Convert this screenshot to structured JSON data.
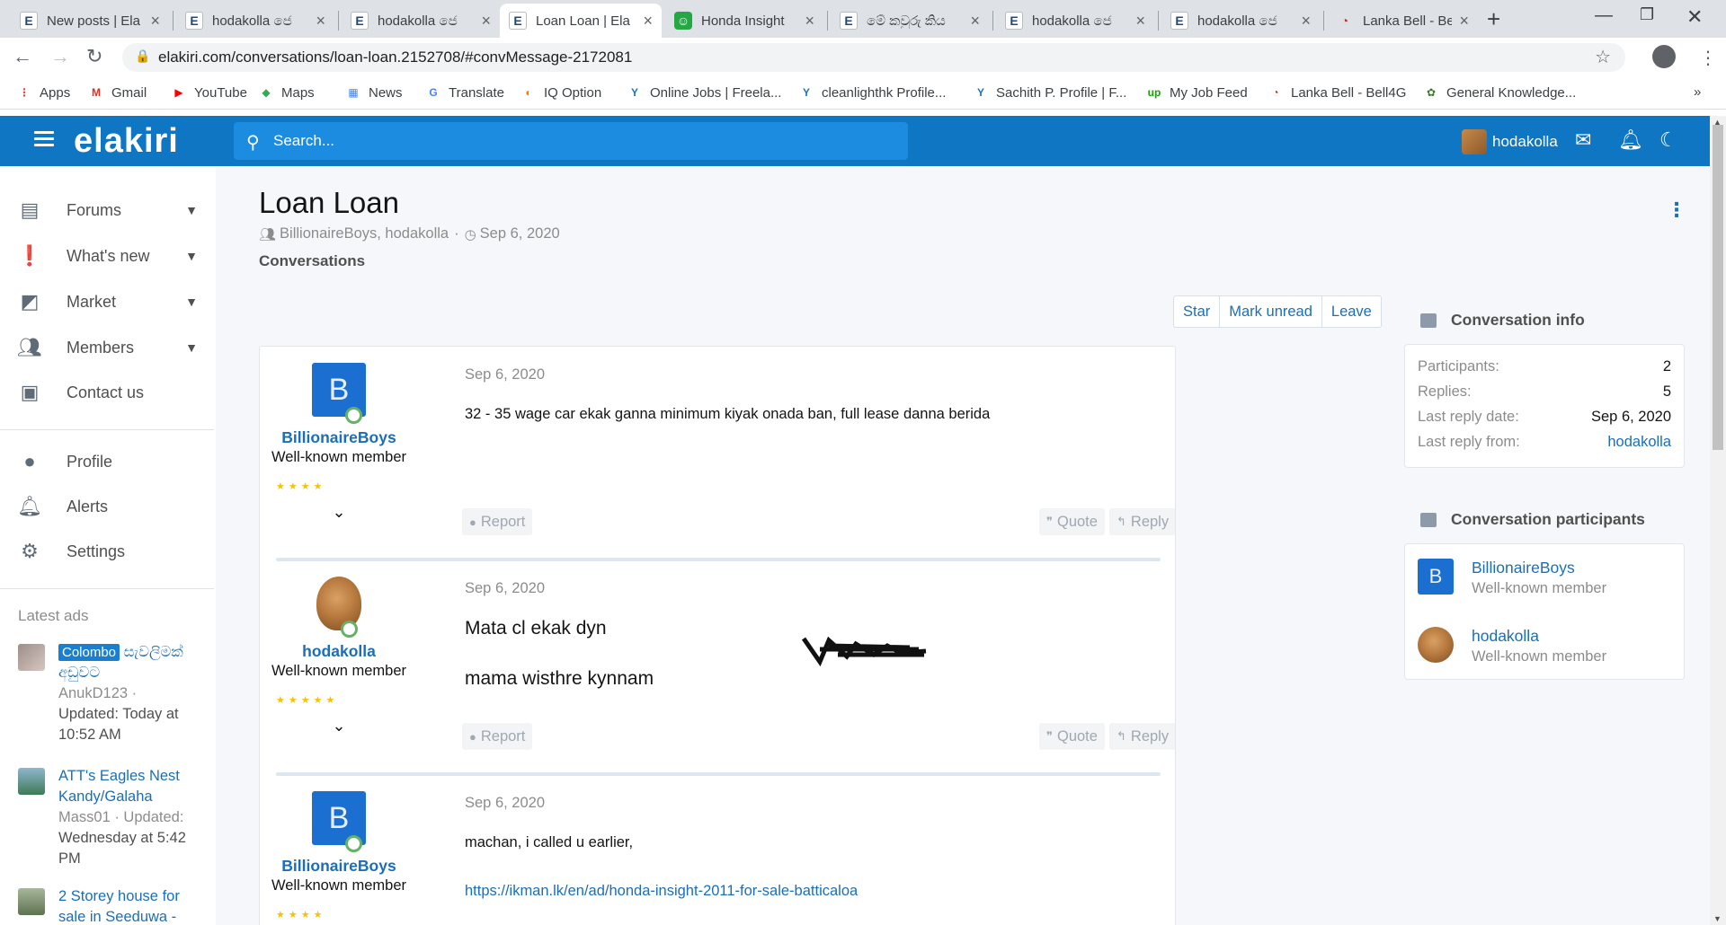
{
  "browser": {
    "tabs": [
      {
        "title": "New posts | Ela",
        "icon": "ek",
        "active": false
      },
      {
        "title": "hodakolla ජෙ",
        "icon": "ek",
        "active": false
      },
      {
        "title": "hodakolla ජෙ",
        "icon": "ek",
        "active": false
      },
      {
        "title": "Loan Loan | Ela",
        "icon": "ek",
        "active": true
      },
      {
        "title": "Honda Insight",
        "icon": "honda",
        "active": false
      },
      {
        "title": "මේ කවුරු කිය",
        "icon": "ek",
        "active": false
      },
      {
        "title": "hodakolla ජෙ",
        "icon": "ek",
        "active": false
      },
      {
        "title": "hodakolla ජෙ",
        "icon": "ek",
        "active": false
      },
      {
        "title": "Lanka Bell - Bel",
        "icon": "bell",
        "active": false
      }
    ],
    "url": "elakiri.com/conversations/loan-loan.2152708/#convMessage-2172081",
    "bookmarks": [
      {
        "label": "Apps",
        "icon": "apps-grid-icon",
        "color": "#e94335"
      },
      {
        "label": "Gmail",
        "icon": "gmail-icon",
        "color": "#d93025"
      },
      {
        "label": "YouTube",
        "icon": "youtube-icon",
        "color": "#ff0000"
      },
      {
        "label": "Maps",
        "icon": "maps-icon",
        "color": "#34a853"
      },
      {
        "label": "News",
        "icon": "news-icon",
        "color": "#4285f4"
      },
      {
        "label": "Translate",
        "icon": "translate-icon",
        "color": "#4285f4"
      },
      {
        "label": "IQ Option",
        "icon": "iq-option-icon",
        "color": "#f57c00"
      },
      {
        "label": "Online Jobs | Freela...",
        "icon": "freelancer-icon",
        "color": "#1c75bc"
      },
      {
        "label": "cleanlighthk Profile...",
        "icon": "freelancer-icon",
        "color": "#1c75bc"
      },
      {
        "label": "Sachith P. Profile | F...",
        "icon": "freelancer-icon",
        "color": "#1c75bc"
      },
      {
        "label": "My Job Feed",
        "icon": "upwork-icon",
        "color": "#14a800"
      },
      {
        "label": "Lanka Bell - Bell4G",
        "icon": "lanka-bell-icon",
        "color": "#d0312d"
      },
      {
        "label": "General Knowledge...",
        "icon": "general-knowledge-icon",
        "color": "#3b7a2a"
      }
    ],
    "more_bookmarks": "»"
  },
  "header": {
    "logo": "elakiri",
    "search_placeholder": "Search...",
    "username": "hodakolla",
    "brand_color": "#0e76c3"
  },
  "sidebar": {
    "nav": [
      {
        "label": "Forums",
        "icon": "forums-icon",
        "has_menu": true
      },
      {
        "label": "What's new",
        "icon": "whats-new-icon",
        "has_menu": true
      },
      {
        "label": "Market",
        "icon": "market-icon",
        "has_menu": true
      },
      {
        "label": "Members",
        "icon": "members-icon",
        "has_menu": true
      },
      {
        "label": "Contact us",
        "icon": "contact-icon",
        "has_menu": false
      }
    ],
    "account": [
      {
        "label": "Profile",
        "icon": "person-icon"
      },
      {
        "label": "Alerts",
        "icon": "bell-icon"
      },
      {
        "label": "Settings",
        "icon": "gear-icon"
      }
    ],
    "latest_ads_title": "Latest ads",
    "ads": [
      {
        "tag": "Colombo",
        "title_lines": [
          "සැවලිමක්",
          "අඩුවට"
        ],
        "meta_lines": [
          "AnukD123 ·"
        ],
        "meta2_lines": [
          "Updated: Today at",
          "10:52 AM"
        ]
      },
      {
        "tag": "",
        "title_lines": [
          "ATT's Eagles Nest",
          "Kandy/Galaha"
        ],
        "meta_lines": [
          "Mass01 · Updated:"
        ],
        "meta2_lines": [
          "Wednesday at 5:42",
          "PM"
        ]
      },
      {
        "tag": "",
        "title_lines": [
          "2 Storey house for",
          "sale in Seeduwa -"
        ],
        "meta_lines": [],
        "meta2_lines": []
      }
    ]
  },
  "conversation": {
    "title": "Loan Loan",
    "participants_line": "BillionaireBoys, hodakolla",
    "date": "Sep 6, 2020",
    "breadcrumb": "Conversations",
    "actions": [
      "Star",
      "Mark unread",
      "Leave"
    ],
    "messages": [
      {
        "author": "BillionaireBoys",
        "avatar_letter": "B",
        "user_title": "Well-known member",
        "stars": "★★★★",
        "date": "Sep 6, 2020",
        "lines": [
          "32 - 35 wage car ekak ganna minimum kiyak onada ban, full lease danna berida"
        ],
        "link": "",
        "report": "Report",
        "quote": "Quote",
        "reply": "Reply"
      },
      {
        "author": "hodakolla",
        "avatar_letter": "",
        "user_title": "Well-known member",
        "stars": "★★★★★",
        "date": "Sep 6, 2020",
        "lines": [
          "Mata cl ekak dyn",
          "mama wisthre kynnam"
        ],
        "link": "",
        "report": "Report",
        "quote": "Quote",
        "reply": "Reply"
      },
      {
        "author": "BillionaireBoys",
        "avatar_letter": "B",
        "user_title": "Well-known member",
        "stars": "★★★★",
        "date": "Sep 6, 2020",
        "lines": [
          "machan, i called u earlier,"
        ],
        "link": "https://ikman.lk/en/ad/honda-insight-2011-for-sale-batticaloa",
        "report": "",
        "quote": "",
        "reply": ""
      }
    ]
  },
  "info": {
    "title": "Conversation info",
    "rows": [
      {
        "label": "Participants:",
        "value": "2",
        "link": false
      },
      {
        "label": "Replies:",
        "value": "5",
        "link": false
      },
      {
        "label": "Last reply date:",
        "value": "Sep 6, 2020",
        "link": false
      },
      {
        "label": "Last reply from:",
        "value": "hodakolla",
        "link": true
      }
    ]
  },
  "participants": {
    "title": "Conversation participants",
    "list": [
      {
        "name": "BillionaireBoys",
        "title": "Well-known member",
        "avatar_letter": "B"
      },
      {
        "name": "hodakolla",
        "title": "Well-known member",
        "avatar_letter": ""
      }
    ]
  }
}
